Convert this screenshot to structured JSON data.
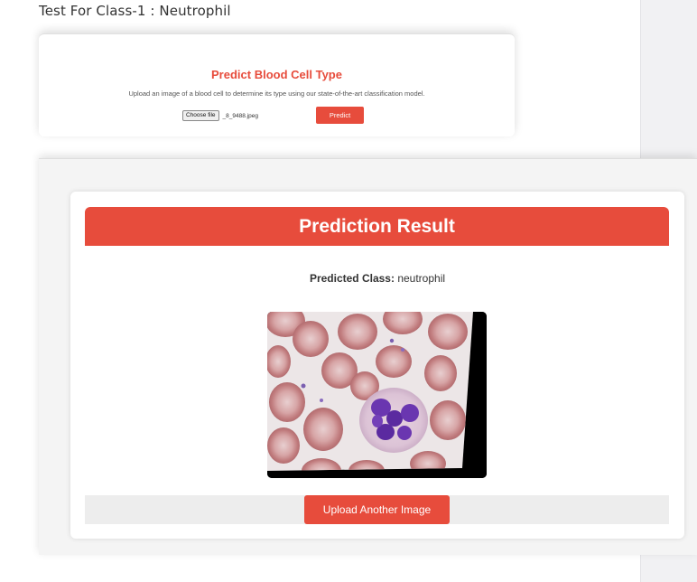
{
  "page": {
    "heading": "Test For Class-1 : Neutrophil"
  },
  "upload_form": {
    "title": "Predict Blood Cell Type",
    "description": "Upload an image of a blood cell to determine its type using our state-of-the-art classification model.",
    "file_button_label": "Choose file",
    "file_name": "_8_9488.jpeg",
    "predict_label": "Predict"
  },
  "result": {
    "title": "Prediction Result",
    "predicted_label": "Predicted Class:",
    "predicted_value": "neutrophil",
    "upload_another_label": "Upload Another Image"
  },
  "colors": {
    "accent": "#e74c3c"
  }
}
